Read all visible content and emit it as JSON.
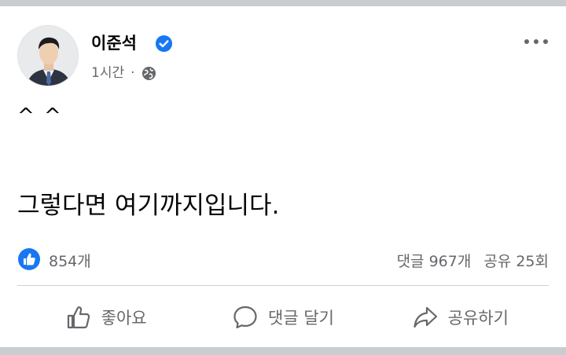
{
  "post": {
    "author": "이준석",
    "time": "1시간",
    "separator": "·",
    "line1": "^ ^",
    "line2": "그렇다면 여기까지입니다."
  },
  "stats": {
    "likes": "854개",
    "comments": "댓글 967개",
    "shares": "공유 25회"
  },
  "actions": {
    "like": "좋아요",
    "comment": "댓글 달기",
    "share": "공유하기"
  },
  "icons": [
    "verified-icon",
    "globe-icon",
    "more-icon",
    "like-badge-icon",
    "thumbs-up-icon",
    "comment-icon",
    "share-icon"
  ],
  "colors": {
    "brand": "#1877f2",
    "text": "#050505",
    "muted": "#65676b"
  }
}
